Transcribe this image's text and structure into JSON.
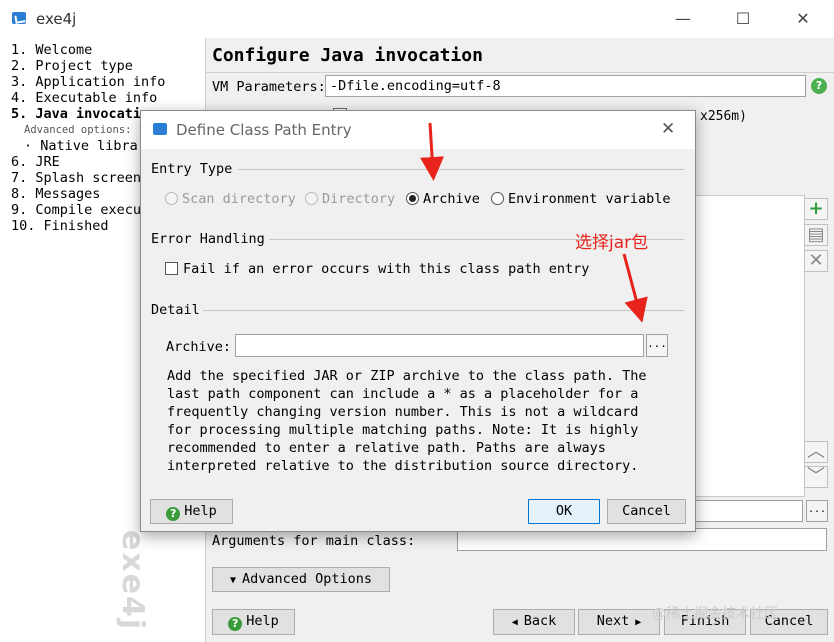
{
  "window": {
    "title": "exe4j",
    "controls": {
      "minimize": "—",
      "maximize": "☐",
      "close": "✕"
    }
  },
  "sidebar": {
    "items": [
      {
        "label": "1. Welcome"
      },
      {
        "label": "2. Project type"
      },
      {
        "label": "3. Application info"
      },
      {
        "label": "4. Executable info"
      },
      {
        "label": "5. Java invocati"
      },
      {
        "label": "Advanced options:"
      },
      {
        "label": "· Native librar"
      },
      {
        "label": "6. JRE"
      },
      {
        "label": "7. Splash screen"
      },
      {
        "label": "8. Messages"
      },
      {
        "label": "9. Compile execu"
      },
      {
        "label": "10. Finished"
      }
    ],
    "watermark": "exe4j"
  },
  "main": {
    "title": "Configure Java invocation",
    "vm_label": "VM Parameters:",
    "vm_value": "-Dfile.encoding=utf-8",
    "bg_text": "x256m)",
    "browse": "...",
    "args_label": "Arguments for main class:",
    "advanced_options": "Advanced Options",
    "help": "Help",
    "back": "Back",
    "next": "Next",
    "finish": "Finish",
    "cancel": "Cancel",
    "watermark": "@稀土掘金技术社区"
  },
  "dialog": {
    "title": "Define Class Path Entry",
    "entry_type_label": "Entry Type",
    "entry_types": [
      {
        "label": "Scan directory",
        "state": "disabled"
      },
      {
        "label": "Directory",
        "state": "disabled"
      },
      {
        "label": "Archive",
        "state": "selected"
      },
      {
        "label": "Environment variable",
        "state": "normal"
      }
    ],
    "error_handling_label": "Error Handling",
    "fail_checkbox": "Fail if an error occurs with this class path entry",
    "detail_label": "Detail",
    "archive_label": "Archive:",
    "archive_value": "",
    "browse": "...",
    "description": "Add the specified JAR or ZIP archive to the class path. The\nlast path component can include a * as a placeholder for a\nfrequently changing version number. This is not a wildcard\nfor processing multiple matching paths. Note: It is highly\nrecommended to enter a relative path. Paths are always\ninterpreted relative to the distribution source directory.",
    "help": "Help",
    "ok": "OK",
    "cancel": "Cancel"
  },
  "annotation": {
    "text": "选择jar包",
    "color": "#e8231b"
  }
}
